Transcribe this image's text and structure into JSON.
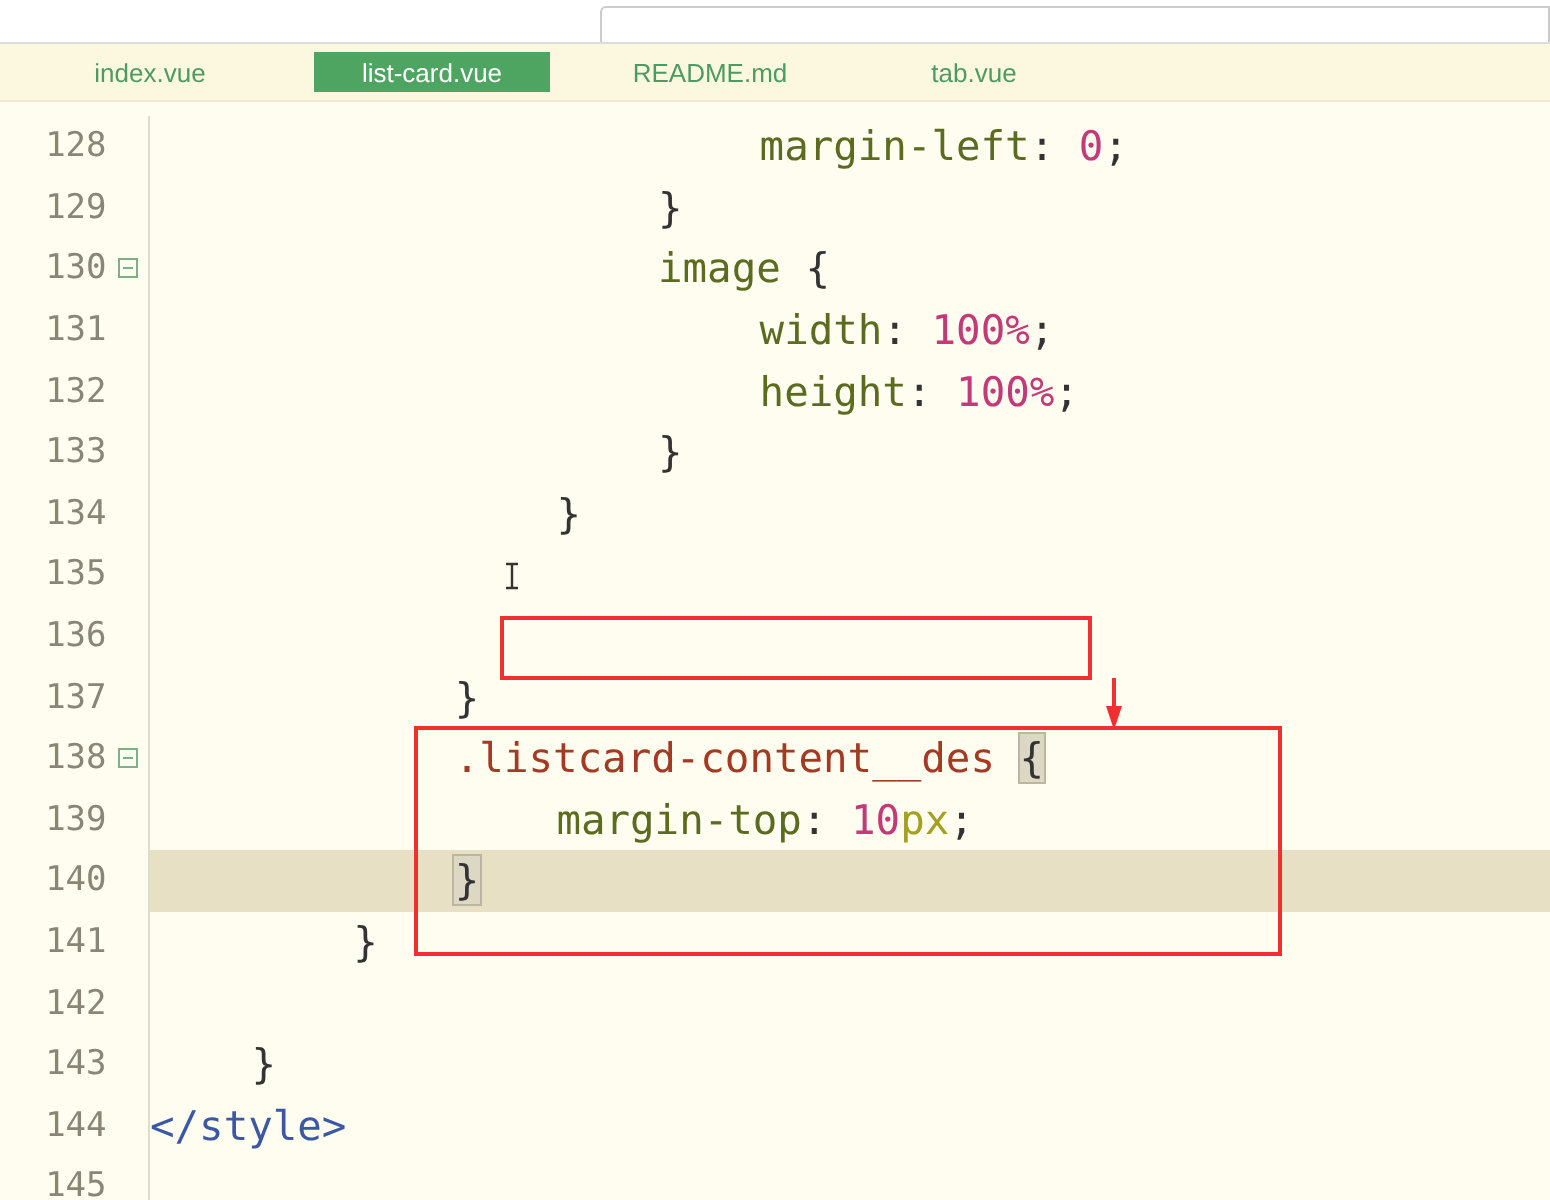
{
  "tabs": [
    {
      "label": "index.vue",
      "selected": false
    },
    {
      "label": "list-card.vue",
      "selected": true
    },
    {
      "label": "README.md",
      "selected": false
    },
    {
      "label": "tab.vue",
      "selected": false
    }
  ],
  "editor": {
    "lines": [
      {
        "children": [
          {
            "children": [
              {
                "children": [
                  {
                    "children": [
                      {
                        "children": [
                          {
                            "children": [
                              {
                                "number": "128",
                                "tokens": [
                                  {
                                    "kind": "property",
                                    "text": "margin-left"
                                  },
                                  {
                                    "kind": "punct",
                                    "text": ":"
                                  },
                                  {
                                    "kind": "number",
                                    "text": "0"
                                  },
                                  {
                                    "kind": "punct",
                                    "text": ";"
                                  }
                                ]
                              }
                            ]
                          },
                          {
                            "number": "129",
                            "tokens": [
                              {
                                "kind": "punct",
                                "text": "}"
                              }
                            ]
                          },
                          {
                            "number": "130",
                            "fold": true,
                            "tokens": [
                              {
                                "kind": "property",
                                "text": "image"
                              },
                              {
                                "kind": "punct",
                                "text": "{"
                              }
                            ],
                            "children": [
                              {
                                "number": "131",
                                "tokens": [
                                  {
                                    "kind": "property",
                                    "text": "width"
                                  },
                                  {
                                    "kind": "punct",
                                    "text": ":"
                                  },
                                  {
                                    "kind": "number",
                                    "text": "100%"
                                  },
                                  {
                                    "kind": "punct",
                                    "text": ";"
                                  }
                                ]
                              },
                              {
                                "number": "132",
                                "tokens": [
                                  {
                                    "kind": "property",
                                    "text": "height"
                                  },
                                  {
                                    "kind": "punct",
                                    "text": ":"
                                  },
                                  {
                                    "kind": "number",
                                    "text": "100%"
                                  },
                                  {
                                    "kind": "punct",
                                    "text": ";"
                                  }
                                ]
                              }
                            ]
                          },
                          {
                            "number": "133",
                            "tokens": [
                              {
                                "kind": "punct",
                                "text": "}"
                              }
                            ]
                          }
                        ]
                      },
                      {
                        "number": "134",
                        "tokens": [
                          {
                            "kind": "punct",
                            "text": "}"
                          }
                        ]
                      },
                      {
                        "number": "135"
                      },
                      {
                        "number": "136"
                      }
                    ]
                  },
                  {
                    "number": "137",
                    "tokens": [
                      {
                        "kind": "punct",
                        "text": "}"
                      }
                    ]
                  },
                  {
                    "number": "138",
                    "fold": true,
                    "tokens": [
                      {
                        "kind": "selector",
                        "text": ".listcard-content__des"
                      },
                      {
                        "kind": "brace",
                        "text": "{",
                        "matched": true
                      }
                    ],
                    "children": [
                      {
                        "number": "139",
                        "tokens": [
                          {
                            "kind": "property",
                            "text": "margin-top"
                          },
                          {
                            "kind": "punct",
                            "text": ":"
                          },
                          {
                            "kind": "number",
                            "text": "10"
                          },
                          {
                            "kind": "unit",
                            "text": "px"
                          },
                          {
                            "kind": "punct",
                            "text": ";"
                          }
                        ]
                      }
                    ]
                  },
                  {
                    "number": "140",
                    "current": true,
                    "tokens": [
                      {
                        "kind": "brace",
                        "text": "}",
                        "matched": true
                      }
                    ]
                  }
                ]
              },
              {
                "number": "141",
                "tokens": [
                  {
                    "kind": "punct",
                    "text": "}"
                  }
                ]
              },
              {
                "number": "142"
              }
            ]
          },
          {
            "number": "143",
            "tokens": [
              {
                "kind": "punct",
                "text": "}"
              }
            ]
          }
        ]
      },
      {
        "number": "144",
        "tokens": [
          {
            "kind": "tag",
            "text": "</style>"
          }
        ]
      },
      {
        "number": "145"
      }
    ]
  }
}
